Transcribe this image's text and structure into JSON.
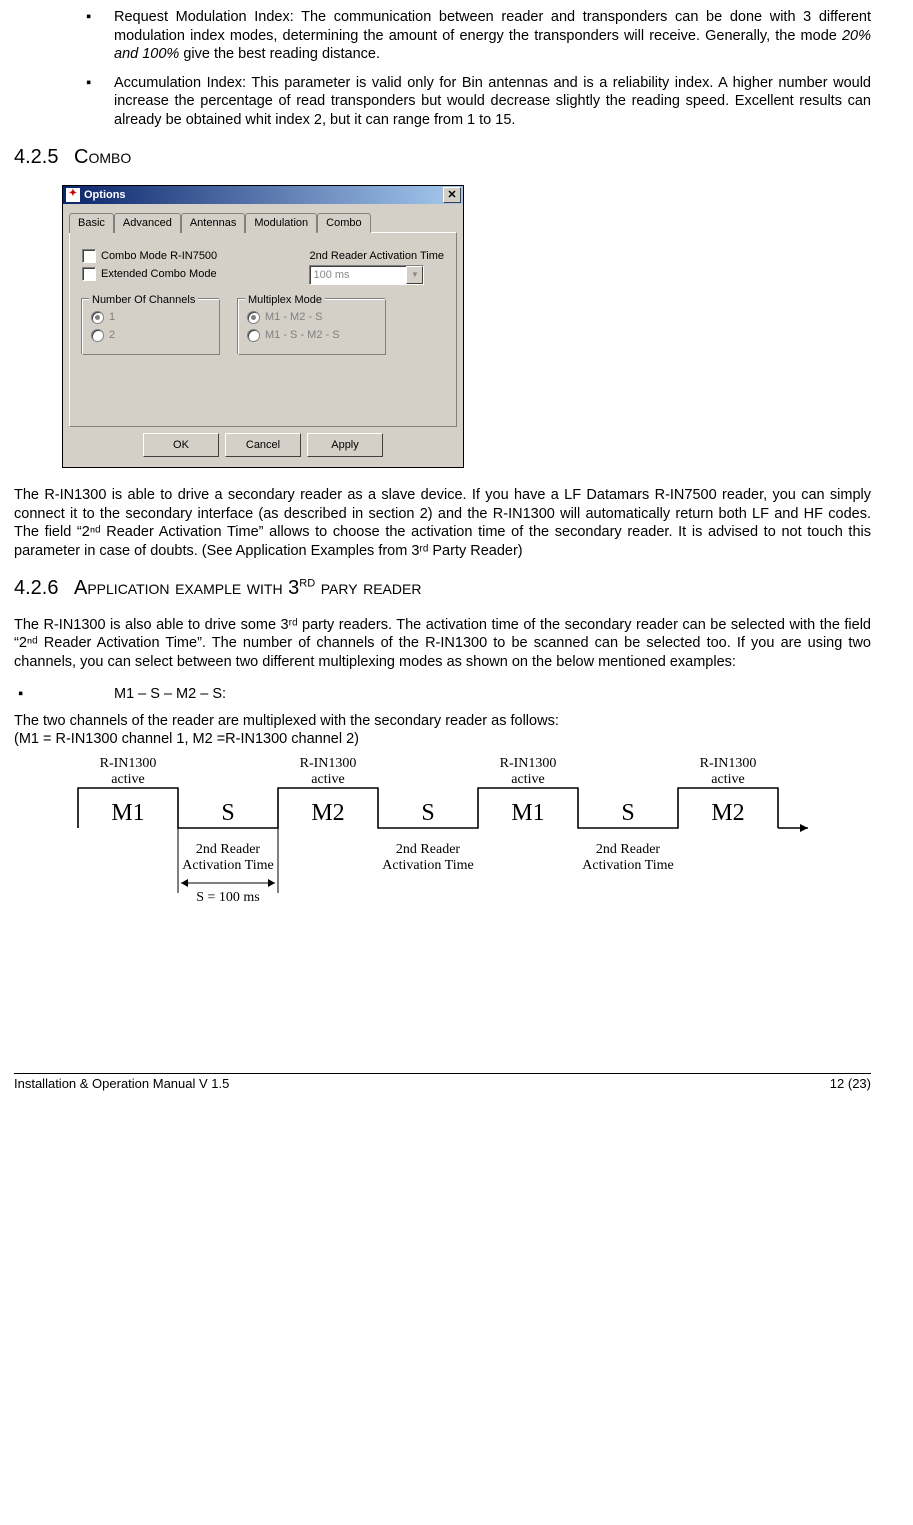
{
  "bullets_top": [
    {
      "lead": "Request Modulation Index:",
      "rest": " The communication between reader and transponders can be done with 3 different modulation index modes, determining the amount of energy the transponders will receive. Generally, the mode ",
      "ital": "20% and 100%",
      "tail": " give the best reading distance."
    },
    {
      "lead": "Accumulation Index:",
      "rest": " This parameter is valid only for Bin antennas and is a reliability index. A higher number would increase the percentage of read transponders but would decrease slightly the reading speed. Excellent results can already be obtained whit index 2, but it can range from 1 to 15.",
      "ital": "",
      "tail": ""
    }
  ],
  "sec425": {
    "num": "4.2.5",
    "title": "Combo"
  },
  "dialog": {
    "title": "Options",
    "tabs": [
      "Basic",
      "Advanced",
      "Antennas",
      "Modulation",
      "Combo"
    ],
    "active_tab": 4,
    "chk1": "Combo Mode R-IN7500",
    "chk2": "Extended Combo Mode",
    "act_label": "2nd Reader Activation Time",
    "act_value": "100 ms",
    "grp1_title": "Number Of Channels",
    "grp1_opts": [
      "1",
      "2"
    ],
    "grp2_title": "Multiplex Mode",
    "grp2_opts": [
      "M1 - M2 - S",
      "M1 - S - M2 - S"
    ],
    "buttons": [
      "OK",
      "Cancel",
      "Apply"
    ]
  },
  "para425": "The R-IN1300 is able to drive a secondary reader as a slave device. If you have a LF Datamars R-IN7500 reader,  you can simply connect it to the secondary interface (as described in section 2) and the R-IN1300 will automatically return both LF and HF codes. The field “2ⁿᵈ Reader Activation Time” allows to choose the activation time of the secondary reader. It is advised to not  touch this parameter in case of doubts. (See Application Examples from 3ʳᵈ Party Reader)",
  "sec426": {
    "num": "4.2.6",
    "title_pre": "Application example with 3",
    "title_sup": "RD",
    "title_post": " pary reader"
  },
  "para426": "The R-IN1300 is also able to drive some 3ʳᵈ party readers. The activation time of the secondary reader can be selected with the field “2ⁿᵈ Reader Activation Time”. The number of channels of the R-IN1300 to be scanned can be selected too. If  you are using two channels, you can select between two different multiplexing modes as shown on the below mentioned examples:",
  "mode_line": "M1 – S – M2 – S:",
  "mode_desc1": "The  two channels of  the reader are multiplexed with the secondary reader as follows:",
  "mode_desc2": " (M1 = R-IN1300 channel 1, M2 =R-IN1300  channel 2)",
  "timing": {
    "top_label": "R-IN1300\nactive",
    "slots": [
      "M1",
      "S",
      "M2",
      "S",
      "M1",
      "S",
      "M2"
    ],
    "sub_label": "2nd Reader\nActivation Time",
    "s_note": "S = 100 ms"
  },
  "footer": {
    "left": "Installation & Operation Manual V 1.5",
    "right": "12 (23)"
  }
}
